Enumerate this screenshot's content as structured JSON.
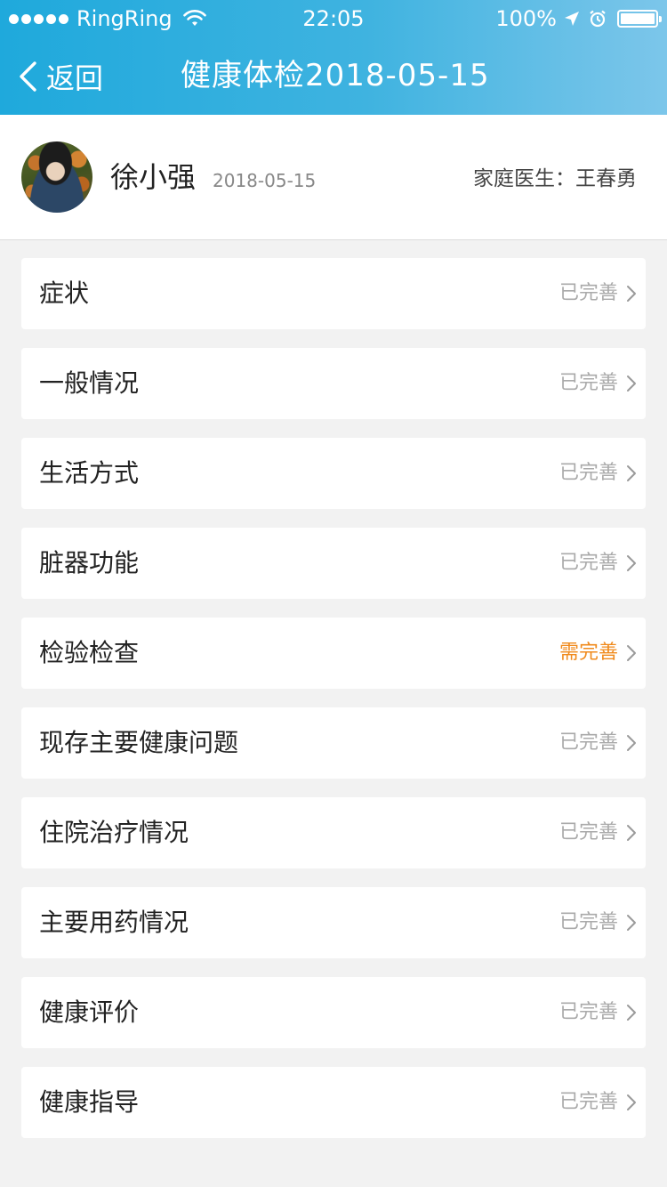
{
  "status_bar": {
    "carrier": "RingRing",
    "time": "22:05",
    "battery": "100%"
  },
  "nav": {
    "back_label": "返回",
    "title": "健康体检2018-05-15"
  },
  "profile": {
    "name": "徐小强",
    "date": "2018-05-15",
    "doctor": "家庭医生：王春勇"
  },
  "colors": {
    "header_start": "#1fa9dc",
    "header_end": "#7cc6ea",
    "status_done": "#aaaaaa",
    "status_pending": "#f08a1c"
  },
  "items": [
    {
      "label": "症状",
      "status": "已完善",
      "pending": false
    },
    {
      "label": "一般情况",
      "status": "已完善",
      "pending": false
    },
    {
      "label": "生活方式",
      "status": "已完善",
      "pending": false
    },
    {
      "label": "脏器功能",
      "status": "已完善",
      "pending": false
    },
    {
      "label": "检验检查",
      "status": "需完善",
      "pending": true
    },
    {
      "label": "现存主要健康问题",
      "status": "已完善",
      "pending": false
    },
    {
      "label": "住院治疗情况",
      "status": "已完善",
      "pending": false
    },
    {
      "label": "主要用药情况",
      "status": "已完善",
      "pending": false
    },
    {
      "label": "健康评价",
      "status": "已完善",
      "pending": false
    },
    {
      "label": "健康指导",
      "status": "已完善",
      "pending": false
    }
  ]
}
